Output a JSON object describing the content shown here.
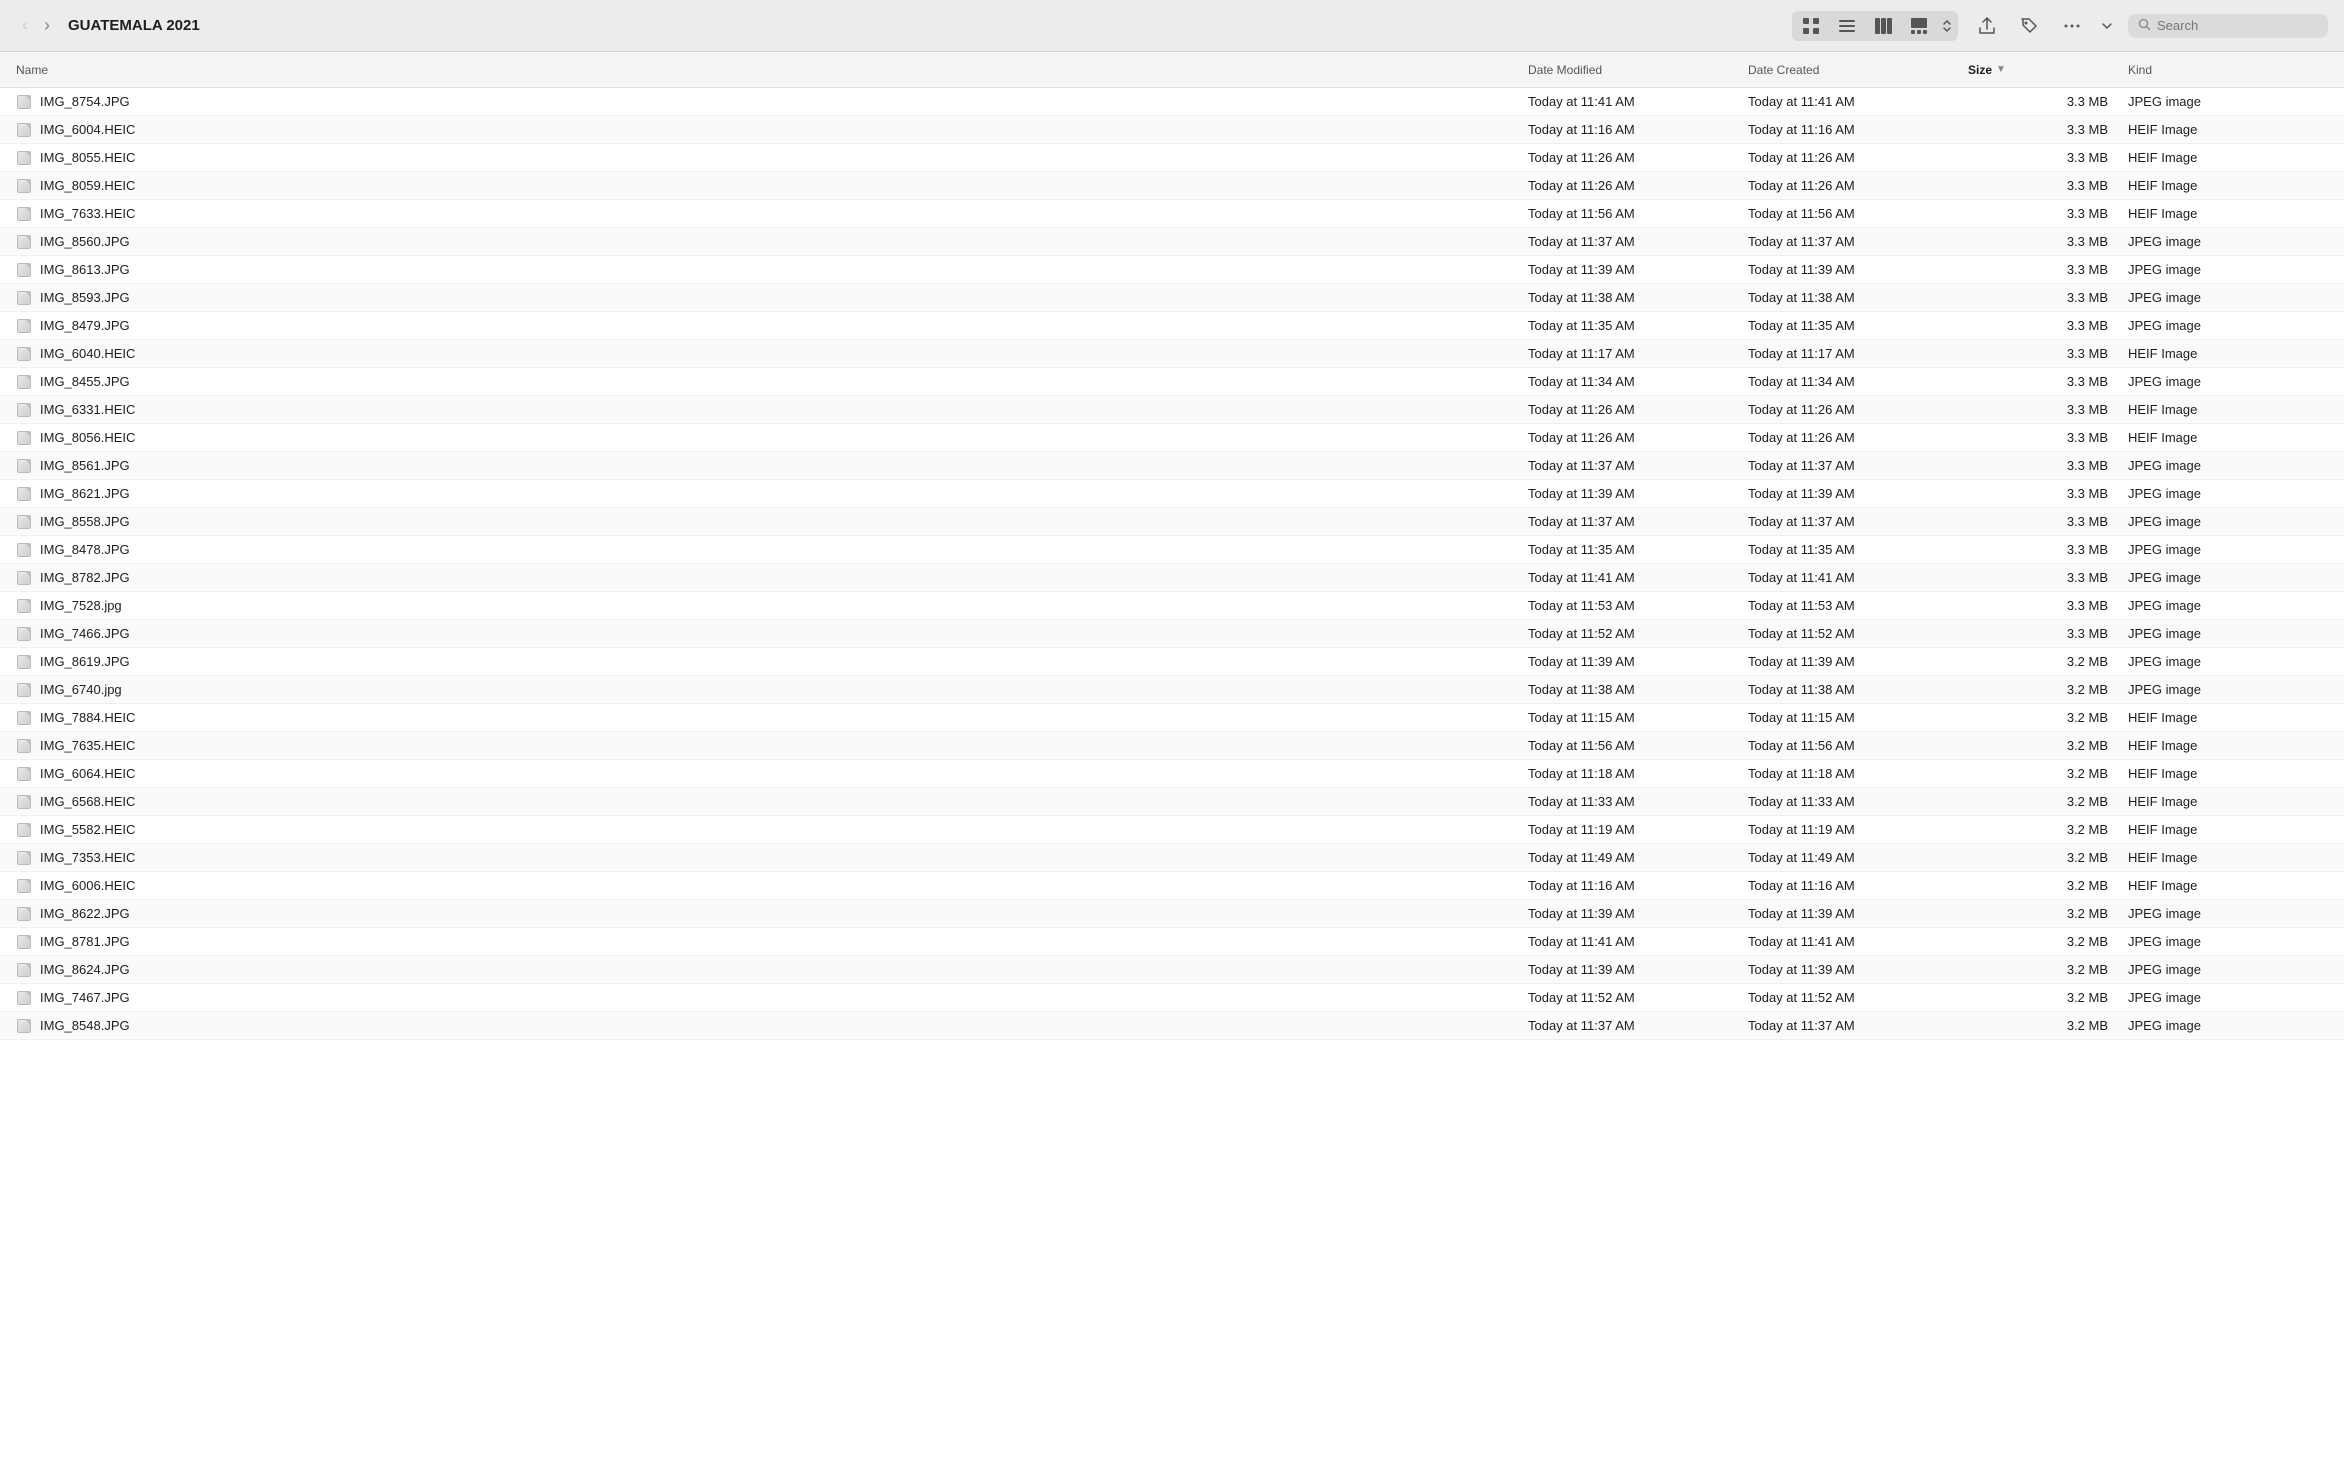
{
  "toolbar": {
    "back_button": "‹",
    "forward_button": "›",
    "title": "GUATEMALA 2021",
    "view_icons": [
      "⊞",
      "☰",
      "⊟",
      "▦"
    ],
    "action_share": "↑",
    "action_tag": "🏷",
    "action_more": "···",
    "action_dropdown": "▾",
    "search_placeholder": "Search"
  },
  "columns": [
    {
      "id": "name",
      "label": "Name",
      "active": false
    },
    {
      "id": "date_modified",
      "label": "Date Modified",
      "active": false
    },
    {
      "id": "date_created",
      "label": "Date Created",
      "active": false
    },
    {
      "id": "size",
      "label": "Size",
      "active": true
    },
    {
      "id": "kind",
      "label": "Kind",
      "active": false
    }
  ],
  "files": [
    {
      "name": "IMG_8754.JPG",
      "date_modified": "Today at 11:41 AM",
      "date_created": "Today at 11:41 AM",
      "size": "3.3 MB",
      "kind": "JPEG image"
    },
    {
      "name": "IMG_6004.HEIC",
      "date_modified": "Today at 11:16 AM",
      "date_created": "Today at 11:16 AM",
      "size": "3.3 MB",
      "kind": "HEIF Image"
    },
    {
      "name": "IMG_8055.HEIC",
      "date_modified": "Today at 11:26 AM",
      "date_created": "Today at 11:26 AM",
      "size": "3.3 MB",
      "kind": "HEIF Image"
    },
    {
      "name": "IMG_8059.HEIC",
      "date_modified": "Today at 11:26 AM",
      "date_created": "Today at 11:26 AM",
      "size": "3.3 MB",
      "kind": "HEIF Image"
    },
    {
      "name": "IMG_7633.HEIC",
      "date_modified": "Today at 11:56 AM",
      "date_created": "Today at 11:56 AM",
      "size": "3.3 MB",
      "kind": "HEIF Image"
    },
    {
      "name": "IMG_8560.JPG",
      "date_modified": "Today at 11:37 AM",
      "date_created": "Today at 11:37 AM",
      "size": "3.3 MB",
      "kind": "JPEG image"
    },
    {
      "name": "IMG_8613.JPG",
      "date_modified": "Today at 11:39 AM",
      "date_created": "Today at 11:39 AM",
      "size": "3.3 MB",
      "kind": "JPEG image"
    },
    {
      "name": "IMG_8593.JPG",
      "date_modified": "Today at 11:38 AM",
      "date_created": "Today at 11:38 AM",
      "size": "3.3 MB",
      "kind": "JPEG image"
    },
    {
      "name": "IMG_8479.JPG",
      "date_modified": "Today at 11:35 AM",
      "date_created": "Today at 11:35 AM",
      "size": "3.3 MB",
      "kind": "JPEG image"
    },
    {
      "name": "IMG_6040.HEIC",
      "date_modified": "Today at 11:17 AM",
      "date_created": "Today at 11:17 AM",
      "size": "3.3 MB",
      "kind": "HEIF Image"
    },
    {
      "name": "IMG_8455.JPG",
      "date_modified": "Today at 11:34 AM",
      "date_created": "Today at 11:34 AM",
      "size": "3.3 MB",
      "kind": "JPEG image"
    },
    {
      "name": "IMG_6331.HEIC",
      "date_modified": "Today at 11:26 AM",
      "date_created": "Today at 11:26 AM",
      "size": "3.3 MB",
      "kind": "HEIF Image"
    },
    {
      "name": "IMG_8056.HEIC",
      "date_modified": "Today at 11:26 AM",
      "date_created": "Today at 11:26 AM",
      "size": "3.3 MB",
      "kind": "HEIF Image"
    },
    {
      "name": "IMG_8561.JPG",
      "date_modified": "Today at 11:37 AM",
      "date_created": "Today at 11:37 AM",
      "size": "3.3 MB",
      "kind": "JPEG image"
    },
    {
      "name": "IMG_8621.JPG",
      "date_modified": "Today at 11:39 AM",
      "date_created": "Today at 11:39 AM",
      "size": "3.3 MB",
      "kind": "JPEG image"
    },
    {
      "name": "IMG_8558.JPG",
      "date_modified": "Today at 11:37 AM",
      "date_created": "Today at 11:37 AM",
      "size": "3.3 MB",
      "kind": "JPEG image"
    },
    {
      "name": "IMG_8478.JPG",
      "date_modified": "Today at 11:35 AM",
      "date_created": "Today at 11:35 AM",
      "size": "3.3 MB",
      "kind": "JPEG image"
    },
    {
      "name": "IMG_8782.JPG",
      "date_modified": "Today at 11:41 AM",
      "date_created": "Today at 11:41 AM",
      "size": "3.3 MB",
      "kind": "JPEG image"
    },
    {
      "name": "IMG_7528.jpg",
      "date_modified": "Today at 11:53 AM",
      "date_created": "Today at 11:53 AM",
      "size": "3.3 MB",
      "kind": "JPEG image"
    },
    {
      "name": "IMG_7466.JPG",
      "date_modified": "Today at 11:52 AM",
      "date_created": "Today at 11:52 AM",
      "size": "3.3 MB",
      "kind": "JPEG image"
    },
    {
      "name": "IMG_8619.JPG",
      "date_modified": "Today at 11:39 AM",
      "date_created": "Today at 11:39 AM",
      "size": "3.2 MB",
      "kind": "JPEG image"
    },
    {
      "name": "IMG_6740.jpg",
      "date_modified": "Today at 11:38 AM",
      "date_created": "Today at 11:38 AM",
      "size": "3.2 MB",
      "kind": "JPEG image"
    },
    {
      "name": "IMG_7884.HEIC",
      "date_modified": "Today at 11:15 AM",
      "date_created": "Today at 11:15 AM",
      "size": "3.2 MB",
      "kind": "HEIF Image"
    },
    {
      "name": "IMG_7635.HEIC",
      "date_modified": "Today at 11:56 AM",
      "date_created": "Today at 11:56 AM",
      "size": "3.2 MB",
      "kind": "HEIF Image"
    },
    {
      "name": "IMG_6064.HEIC",
      "date_modified": "Today at 11:18 AM",
      "date_created": "Today at 11:18 AM",
      "size": "3.2 MB",
      "kind": "HEIF Image"
    },
    {
      "name": "IMG_6568.HEIC",
      "date_modified": "Today at 11:33 AM",
      "date_created": "Today at 11:33 AM",
      "size": "3.2 MB",
      "kind": "HEIF Image"
    },
    {
      "name": "IMG_5582.HEIC",
      "date_modified": "Today at 11:19 AM",
      "date_created": "Today at 11:19 AM",
      "size": "3.2 MB",
      "kind": "HEIF Image"
    },
    {
      "name": "IMG_7353.HEIC",
      "date_modified": "Today at 11:49 AM",
      "date_created": "Today at 11:49 AM",
      "size": "3.2 MB",
      "kind": "HEIF Image"
    },
    {
      "name": "IMG_6006.HEIC",
      "date_modified": "Today at 11:16 AM",
      "date_created": "Today at 11:16 AM",
      "size": "3.2 MB",
      "kind": "HEIF Image"
    },
    {
      "name": "IMG_8622.JPG",
      "date_modified": "Today at 11:39 AM",
      "date_created": "Today at 11:39 AM",
      "size": "3.2 MB",
      "kind": "JPEG image"
    },
    {
      "name": "IMG_8781.JPG",
      "date_modified": "Today at 11:41 AM",
      "date_created": "Today at 11:41 AM",
      "size": "3.2 MB",
      "kind": "JPEG image"
    },
    {
      "name": "IMG_8624.JPG",
      "date_modified": "Today at 11:39 AM",
      "date_created": "Today at 11:39 AM",
      "size": "3.2 MB",
      "kind": "JPEG image"
    },
    {
      "name": "IMG_7467.JPG",
      "date_modified": "Today at 11:52 AM",
      "date_created": "Today at 11:52 AM",
      "size": "3.2 MB",
      "kind": "JPEG image"
    },
    {
      "name": "IMG_8548.JPG",
      "date_modified": "Today at 11:37 AM",
      "date_created": "Today at 11:37 AM",
      "size": "3.2 MB",
      "kind": "JPEG image"
    }
  ]
}
